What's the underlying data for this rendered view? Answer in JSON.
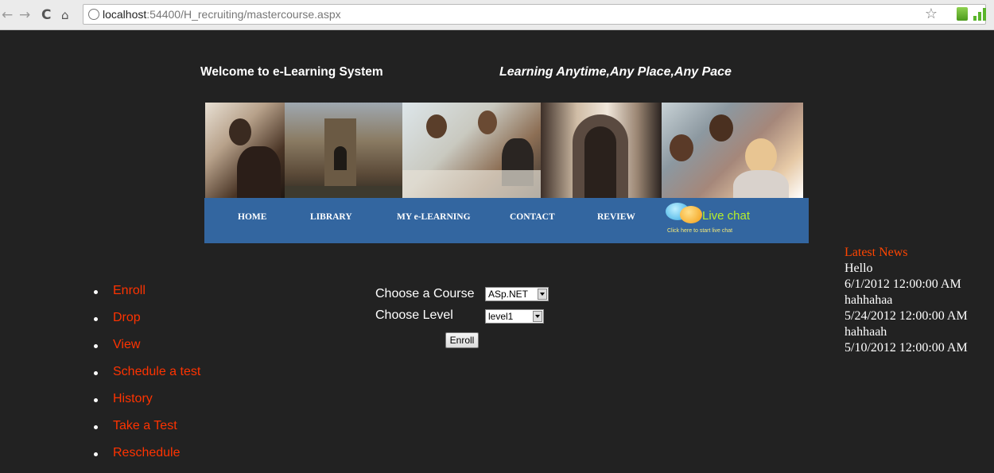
{
  "browser": {
    "back_glyph": "←",
    "forward_glyph": "→",
    "reload_glyph": "C",
    "home_glyph": "🏠",
    "url_host": "localhost",
    "url_rest": ":54400/H_recruiting/mastercourse.aspx",
    "star_glyph": "☆"
  },
  "header": {
    "welcome": "Welcome to e-Learning System",
    "tagline": "Learning Anytime,Any Place,Any Pace"
  },
  "nav": {
    "items": [
      "HOME",
      "LIBRARY",
      "MY e-LEARNING",
      "CONTACT",
      "REVIEW"
    ],
    "livechat_title": "Live chat",
    "livechat_sub": "Click here to start live chat"
  },
  "menu": {
    "items": [
      "Enroll",
      "Drop",
      "View",
      "Schedule a test",
      "History",
      "Take a Test",
      "Reschedule"
    ]
  },
  "form": {
    "course_label": "Choose a Course",
    "course_value": "ASp.NET",
    "level_label": "Choose Level",
    "level_value": "level1",
    "enroll_button": "Enroll"
  },
  "news": {
    "title": "Latest News",
    "lines": [
      "Hello",
      "6/1/2012 12:00:00 AM",
      "hahhahaa",
      "5/24/2012 12:00:00 AM",
      "hahhaah",
      "5/10/2012 12:00:00 AM"
    ]
  },
  "colors": {
    "background": "#222222",
    "nav_bar": "#3366a0",
    "menu_link": "#ff3300",
    "news_title": "#ff4500"
  }
}
